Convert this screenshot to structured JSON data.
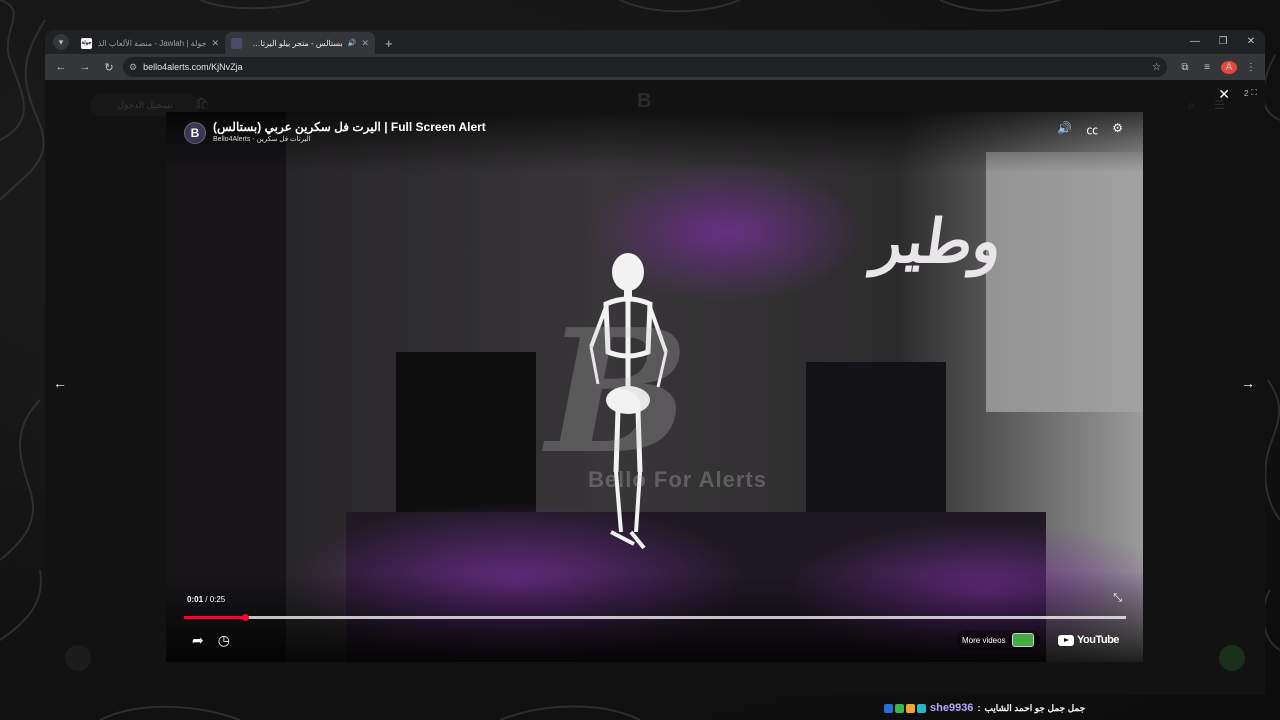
{
  "browser": {
    "tabs": [
      {
        "title": "جولة | Jawlah - منصة الألعاب الذ",
        "favicon_text": "جولة",
        "active": false
      },
      {
        "title": "بستالس - متجر بيلو اليرتات فل",
        "favicon_text": "",
        "active": true
      }
    ],
    "url": "bello4alerts.com/KjNvZja",
    "profile_initial": "A"
  },
  "page_under": {
    "login_label": "تسجيل الدخول",
    "logo_text": "B"
  },
  "lightbox": {
    "counter": "2"
  },
  "video": {
    "title": "اليرت فل سكرين عربي (بستالس) | Full Screen Alert",
    "channel": "Bello4Alerts",
    "subtitle": "اليرتات فل سكرين",
    "overlay_text": "وطير",
    "watermark_letter": "B",
    "watermark_text": "Bello For Alerts",
    "current_time": "0:01",
    "duration": "0:25",
    "progress_fraction": 0.065,
    "more_videos_label": "More videos",
    "youtube_label": "YouTube",
    "accent_color": "#ff0033"
  },
  "chat": {
    "username": "she9936",
    "separator": ":",
    "message": "جمل جمل جو احمد الشايب"
  }
}
